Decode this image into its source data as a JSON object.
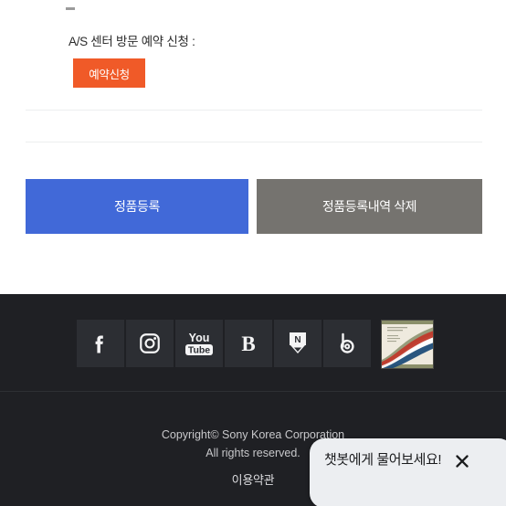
{
  "page": {
    "top_dash": "–",
    "as_request_label": "A/S 센터 방문 예약 신청 :",
    "reserve_button_label": "예약신청"
  },
  "actions": {
    "register_label": "정품등록",
    "delete_label": "정품등록내역 삭제",
    "register_color": "#4169d8",
    "delete_color": "#75736f"
  },
  "footer": {
    "background": "#1f2024",
    "social": [
      {
        "name": "facebook-icon",
        "label": "f"
      },
      {
        "name": "instagram-icon",
        "label": "Instagram"
      },
      {
        "name": "youtube-icon",
        "label": "You Tube"
      },
      {
        "name": "blog-icon",
        "label": "B"
      },
      {
        "name": "naver-icon",
        "label": "N"
      },
      {
        "name": "band-icon",
        "label": "b"
      },
      {
        "name": "brochure-thumbnail",
        "label": "Sony brochure"
      }
    ],
    "copyright_line1": "Copyright© Sony Korea Corporation",
    "copyright_line2": "All rights reserved.",
    "terms_label": "이용약관"
  },
  "chatbot": {
    "message": "챗봇에게 물어보세요!",
    "close_label": "✕",
    "bubble_color": "#eceef1"
  }
}
